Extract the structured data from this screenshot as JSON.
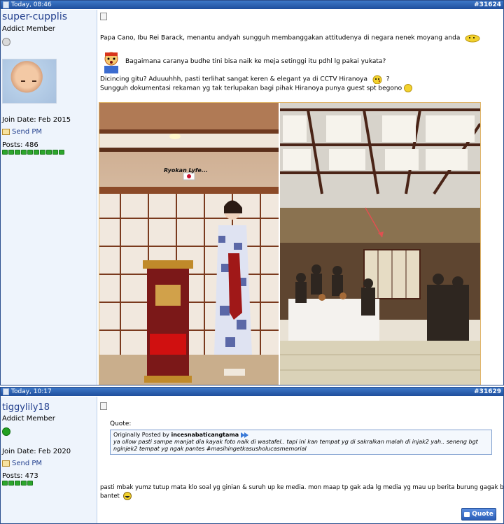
{
  "posts": [
    {
      "header_time": "Today, 08:46",
      "post_number": "#31624",
      "username": "super-cupplis",
      "user_title": "Addict Member",
      "join_date": "Join Date: Feb 2015",
      "send_pm": "Send PM",
      "posts_count": "Posts: 486",
      "status_color": "#d9d9d9",
      "lines": [
        "Papa Cano, Ibu Rei Barack, menantu andyah sungguh membanggakan attitudenya di negara nenek moyang anda",
        "Bagaimana caranya budhe tini bisa naik ke meja setinggi itu pdhl lg pakai yukata?",
        "Dicincing gitu? Aduuuhhh, pasti terlihat sangat keren & elegant ya di CCTV Hiranoya",
        "Sungguh dokumentasi rekaman yg tak terlupakan bagi pihak Hiranoya punya guest spt begono"
      ],
      "photo_caption": "Ryokan Lyfe...",
      "trailing_mark": "?"
    },
    {
      "header_time": "Today, 10:17",
      "post_number": "#31629",
      "username": "tiggylily18",
      "user_title": "Addict Member",
      "join_date": "Join Date: Feb 2020",
      "send_pm": "Send PM",
      "posts_count": "Posts: 473",
      "status_color": "#22a022",
      "quote_label": "Quote:",
      "quote_prefix": "Originally Posted by",
      "quote_author": "incesnabaticangtama",
      "quote_line1": "ya ollow pasti sampe manjat dia kayak foto naik di wastafel.. tapi ini kan tempat yg di sakralkan malah di injak2 yah.. seneng bgt",
      "quote_line2": "nginjek2 tempat yg ngak pantes #masihingetkasusholucasmemorial",
      "body_line1": "pasti mbak yumz tutup mata klo soal yg ginian & suruh up ke media. mon maap tp gak ada lg media yg mau up berita burung gagak bogelita nan",
      "body_line2": "bantet",
      "quote_button": "Quote"
    }
  ],
  "colors": {
    "header_blue": "#1f4e9c",
    "side_bg": "#eef4fc",
    "link_blue": "#23408e"
  }
}
